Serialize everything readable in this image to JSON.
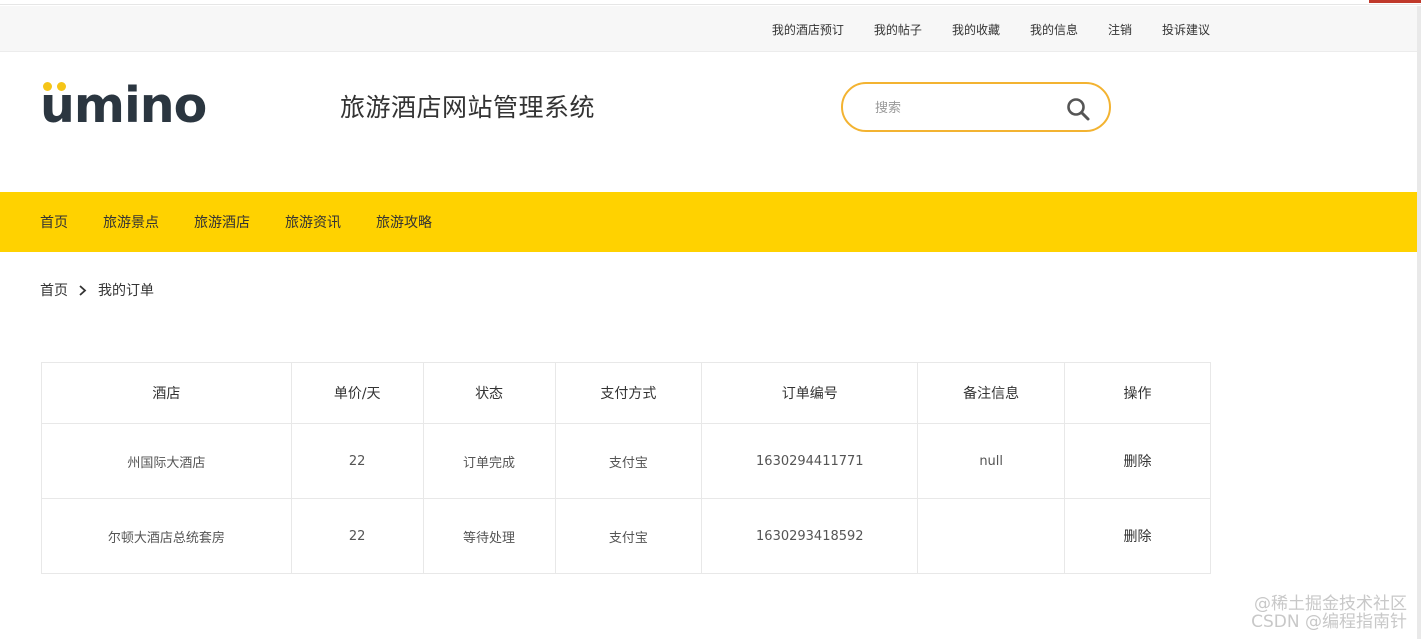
{
  "top_links": [
    "我的酒店预订",
    "我的帖子",
    "我的收藏",
    "我的信息",
    "注销",
    "投诉建议"
  ],
  "logo": {
    "text": "umino"
  },
  "site_title": "旅游酒店网站管理系统",
  "search": {
    "placeholder": "搜索",
    "icon": "search-icon",
    "accent": "#f3b331"
  },
  "nav": {
    "color": "#ffd200",
    "items": [
      "首页",
      "旅游景点",
      "旅游酒店",
      "旅游资讯",
      "旅游攻略"
    ]
  },
  "breadcrumb": {
    "home": "首页",
    "current": "我的订单"
  },
  "orders_table": {
    "headers": [
      "酒店",
      "单价/天",
      "状态",
      "支付方式",
      "订单编号",
      "备注信息",
      "操作"
    ],
    "rows": [
      {
        "hotel": "州国际大酒店",
        "price": "22",
        "status": "订单完成",
        "payment": "支付宝",
        "order_no": "1630294411771",
        "note": "null",
        "action": "删除"
      },
      {
        "hotel": "尔顿大酒店总统套房",
        "price": "22",
        "status": "等待处理",
        "payment": "支付宝",
        "order_no": "1630293418592",
        "note": "",
        "action": "删除"
      }
    ]
  },
  "watermark": [
    "@稀土掘金技术社区",
    "CSDN @编程指南针"
  ]
}
